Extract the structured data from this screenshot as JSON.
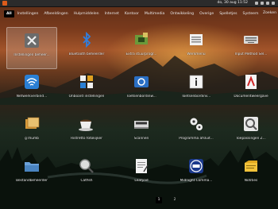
{
  "panel": {
    "clock": "do, 30 aug 11:52"
  },
  "tabs": [
    "All",
    "Instellingen",
    "Afbeeldingen",
    "Hulpmiddelen",
    "Internet",
    "Kantoor",
    "Multimedia",
    "Ontwikkeling",
    "Overige",
    "Spelletjes",
    "Systeem"
  ],
  "active_tab": 0,
  "search_label": "Zoeken",
  "apps": [
    {
      "label": "Instellingen beheer...",
      "icon": "tools-icon"
    },
    {
      "label": "Bluetooth beheerder",
      "icon": "bluetooth-icon"
    },
    {
      "label": "Extra stuurprogr...",
      "icon": "driver-chip-icon"
    },
    {
      "label": "Werkmenu",
      "icon": "menu-list-icon"
    },
    {
      "label": "Input Method Sel...",
      "icon": "keyboard-icon"
    },
    {
      "label": "Netwerkverbind...",
      "icon": "wifi-icon"
    },
    {
      "label": "Onboard instellingen",
      "icon": "onboard-keyboard-icon"
    },
    {
      "label": "Toetsenbordinw...",
      "icon": "keyboard-settings-icon"
    },
    {
      "label": "Toetsenbordinv...",
      "icon": "info-icon"
    },
    {
      "label": "Documentweergave",
      "icon": "pdf-viewer-icon"
    },
    {
      "label": "gThumb",
      "icon": "image-viewer-icon"
    },
    {
      "label": "Ristretto fotokijker",
      "icon": "coffee-cup-icon"
    },
    {
      "label": "Scannen",
      "icon": "scanner-icon"
    },
    {
      "label": "Programma afsluit...",
      "icon": "gears-icon"
    },
    {
      "label": "Toepassingen Z...",
      "icon": "magnifier-app-icon"
    },
    {
      "label": "Bestandbeheerder",
      "icon": "folder-icon"
    },
    {
      "label": "Catfish",
      "icon": "search-magnifier-icon"
    },
    {
      "label": "Leafpad",
      "icon": "text-editor-icon"
    },
    {
      "label": "Midnight Comma...",
      "icon": "midnight-commander-icon"
    },
    {
      "label": "Notities",
      "icon": "notes-icon"
    }
  ],
  "selected_app": 0,
  "pager": {
    "pages": [
      "1",
      "2"
    ],
    "active": 0
  }
}
